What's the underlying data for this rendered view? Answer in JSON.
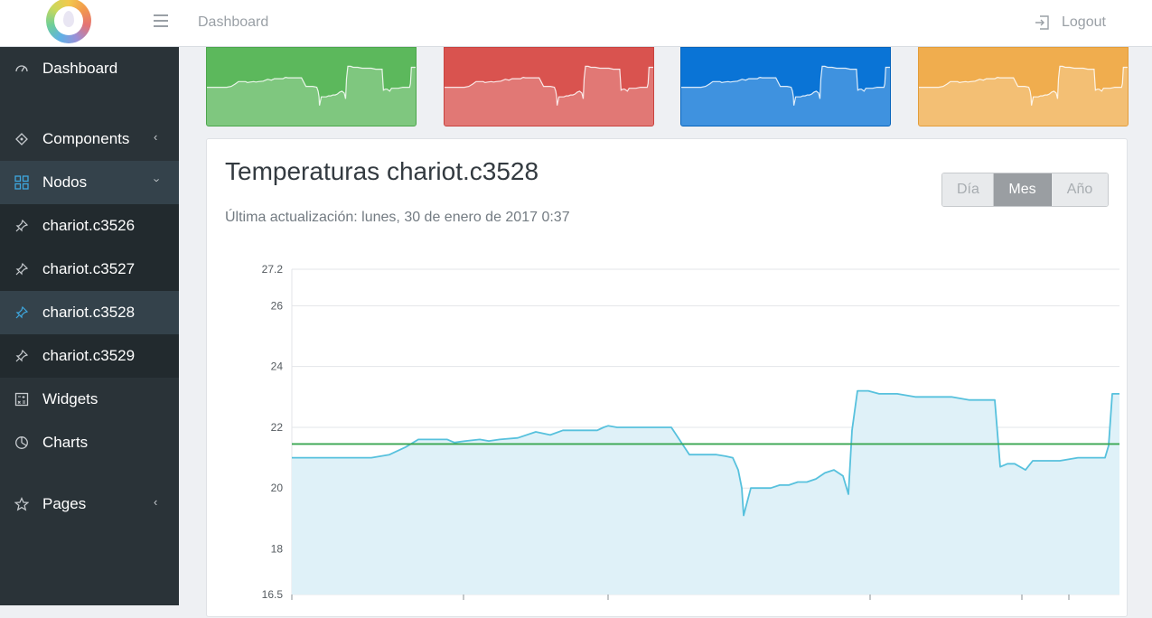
{
  "header": {
    "breadcrumb": "Dashboard",
    "logout_label": "Logout",
    "logo_icon": "logo-icon",
    "menu_icon": "hamburger-icon"
  },
  "sidebar": {
    "items": [
      {
        "label": "Dashboard",
        "icon": "speedometer-icon"
      },
      {
        "label": "Components",
        "icon": "puzzle-icon",
        "chevron": "‹"
      },
      {
        "label": "Nodos",
        "icon": "grid-icon",
        "chevron": "›"
      },
      {
        "label": "chariot.c3526",
        "icon": "pin-icon"
      },
      {
        "label": "chariot.c3527",
        "icon": "pin-icon"
      },
      {
        "label": "chariot.c3528",
        "icon": "pin-icon"
      },
      {
        "label": "chariot.c3529",
        "icon": "pin-icon"
      },
      {
        "label": "Widgets",
        "icon": "calculator-icon"
      },
      {
        "label": "Charts",
        "icon": "pie-chart-icon"
      },
      {
        "label": "Pages",
        "icon": "star-icon",
        "chevron": "‹"
      }
    ]
  },
  "tiles": [
    {
      "color": "#5cb85c"
    },
    {
      "color": "#d9534f"
    },
    {
      "color": "#0a74d6"
    },
    {
      "color": "#f0ad4e"
    }
  ],
  "main": {
    "title": "Temperaturas chariot.c3528",
    "updated": "Última actualización: lunes, 30 de enero de 2017 0:37",
    "range_buttons": [
      "Día",
      "Mes",
      "Año"
    ],
    "selected_range": "Mes"
  },
  "chart_data": {
    "type": "area",
    "ylim": [
      16.5,
      27.2
    ],
    "yticks": [
      "27.2",
      "26",
      "24",
      "22",
      "20",
      "18",
      "16.5"
    ],
    "x": [
      0,
      40,
      48,
      60,
      72,
      88,
      108,
      126,
      140,
      150,
      160,
      172,
      180,
      192,
      208,
      218,
      230,
      250,
      270,
      286,
      300,
      312,
      326,
      338,
      345,
      350,
      360,
      380,
      400,
      420,
      440,
      460,
      470,
      480,
      488,
      494,
      498,
      500,
      508,
      520,
      530,
      540,
      550,
      560,
      570,
      580,
      590,
      600,
      610,
      616,
      620,
      626,
      632,
      638,
      650,
      660,
      670,
      690,
      710,
      730,
      750,
      760,
      770,
      778,
      784,
      792,
      800,
      812,
      820,
      826,
      834,
      850,
      870,
      890,
      900,
      904,
      908,
      916,
      927
    ],
    "series": [
      {
        "values": [
          21.0,
          21.0,
          21.0,
          21.0,
          21.0,
          21.0,
          21.1,
          21.35,
          21.6,
          21.6,
          21.6,
          21.6,
          21.5,
          21.55,
          21.6,
          21.55,
          21.6,
          21.65,
          21.85,
          21.75,
          21.9,
          21.9,
          21.9,
          21.9,
          22.0,
          22.05,
          22.0,
          22.0,
          22.0,
          22.0,
          21.1,
          21.1,
          21.1,
          21.05,
          21.0,
          20.6,
          20.0,
          19.1,
          20.0,
          20.0,
          20.0,
          20.1,
          20.1,
          20.2,
          20.2,
          20.3,
          20.5,
          20.6,
          20.4,
          19.8,
          21.9,
          23.2,
          23.2,
          23.2,
          23.1,
          23.1,
          23.1,
          23.0,
          23.0,
          23.0,
          22.9,
          22.9,
          22.9,
          22.9,
          20.7,
          20.8,
          20.8,
          20.6,
          20.9,
          20.9,
          20.9,
          20.9,
          21.0,
          21.0,
          21.0,
          21.4,
          23.1,
          23.1,
          23.1
        ],
        "color": "#57c1dd"
      }
    ],
    "reference_line": {
      "value": 21.45,
      "color": "#3aa651"
    },
    "grid": true
  }
}
